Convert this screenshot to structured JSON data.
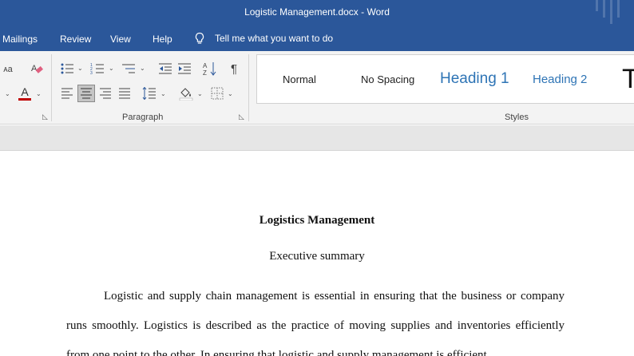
{
  "window": {
    "title": "Logistic Management.docx  -  Word"
  },
  "menu": {
    "items": [
      "Mailings",
      "Review",
      "View",
      "Help"
    ],
    "tell_me": "Tell me what you want to do"
  },
  "ribbon": {
    "font_group": {
      "size_glyph": "ᴀa",
      "font_color_glyph": "A",
      "font_color": "#c00000"
    },
    "paragraph_group": {
      "label": "Paragraph",
      "sort_glyph": "A↓Z",
      "pilcrow": "¶"
    },
    "styles_group": {
      "label": "Styles",
      "items": [
        "Normal",
        "No Spacing",
        "Heading 1",
        "Heading 2",
        "T"
      ]
    }
  },
  "document": {
    "title": "Logistics Management",
    "subtitle": "Executive summary",
    "paragraph": "Logistic and supply chain management is essential in ensuring that the business or company runs smoothly. Logistics is described as the practice of moving supplies and inventories efficiently from one point to the other. In ensuring that logistic and supply management is efficient,"
  },
  "colors": {
    "titlebar": "#2b579a",
    "heading_blue": "#2e74b5",
    "ribbon_bg": "#f3f3f3"
  }
}
